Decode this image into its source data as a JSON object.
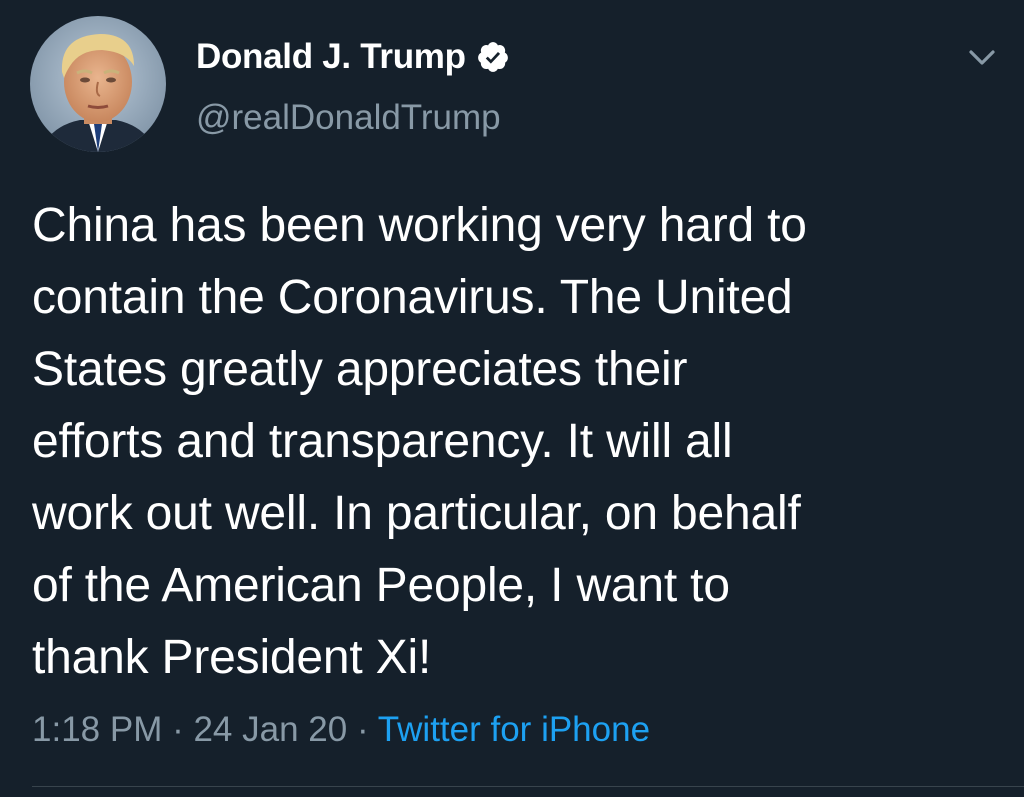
{
  "tweet": {
    "author": {
      "display_name": "Donald J. Trump",
      "handle": "@realDonaldTrump",
      "verified": true,
      "avatar_icon": "profile-photo"
    },
    "menu_icon": "chevron-down-icon",
    "text_lines": [
      "China has been working very hard to",
      "contain the Coronavirus. The United",
      "States greatly appreciates their",
      "efforts and transparency. It will all",
      "work out well. In particular, on behalf",
      "of the American People, I want to",
      "thank President Xi!"
    ],
    "meta": {
      "time": "1:18 PM",
      "separator": " · ",
      "date": "24 Jan 20",
      "source": "Twitter for iPhone"
    }
  },
  "colors": {
    "background": "#15202b",
    "primary_text": "#ffffff",
    "secondary_text": "#8899a6",
    "link": "#1da1f2",
    "divider": "#38444d"
  }
}
